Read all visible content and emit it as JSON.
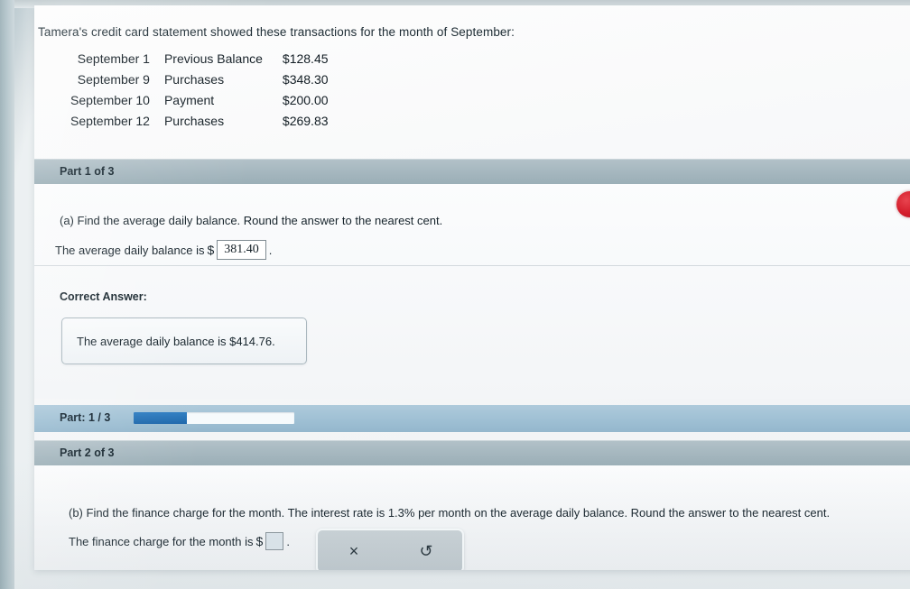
{
  "prompt": "Tamera's credit card statement showed these transactions for the month of September:",
  "transactions": {
    "rows": [
      {
        "date": "September 1",
        "description": "Previous Balance",
        "amount": "$128.45"
      },
      {
        "date": "September 9",
        "description": "Purchases",
        "amount": "$348.30"
      },
      {
        "date": "September 10",
        "description": "Payment",
        "amount": "$200.00"
      },
      {
        "date": "September 12",
        "description": "Purchases",
        "amount": "$269.83"
      }
    ]
  },
  "part1": {
    "header": "Part 1 of 3",
    "question": "(a) Find the average daily balance. Round the answer to the nearest cent.",
    "answer_prefix": "The average daily balance is",
    "dollar_sign": "$",
    "answer_value": "381.40",
    "period": ".",
    "correct_label": "Correct Answer:",
    "correct_text": "The average daily balance is $414.76."
  },
  "progress": {
    "label": "Part: 1 / 3",
    "percent": 33,
    "fill_color": "#1d67ab"
  },
  "part2": {
    "header": "Part 2 of 3",
    "question": "(b) Find the finance charge for the month. The interest rate is 1.3% per month on the average daily balance. Round the answer to the nearest cent.",
    "answer_prefix": "The finance charge for the month is",
    "dollar_sign": "$",
    "answer_value": "",
    "period": "."
  },
  "tools": {
    "clear_icon": "×",
    "undo_icon": "↺"
  },
  "marker": {
    "color": "#d41d2b"
  }
}
